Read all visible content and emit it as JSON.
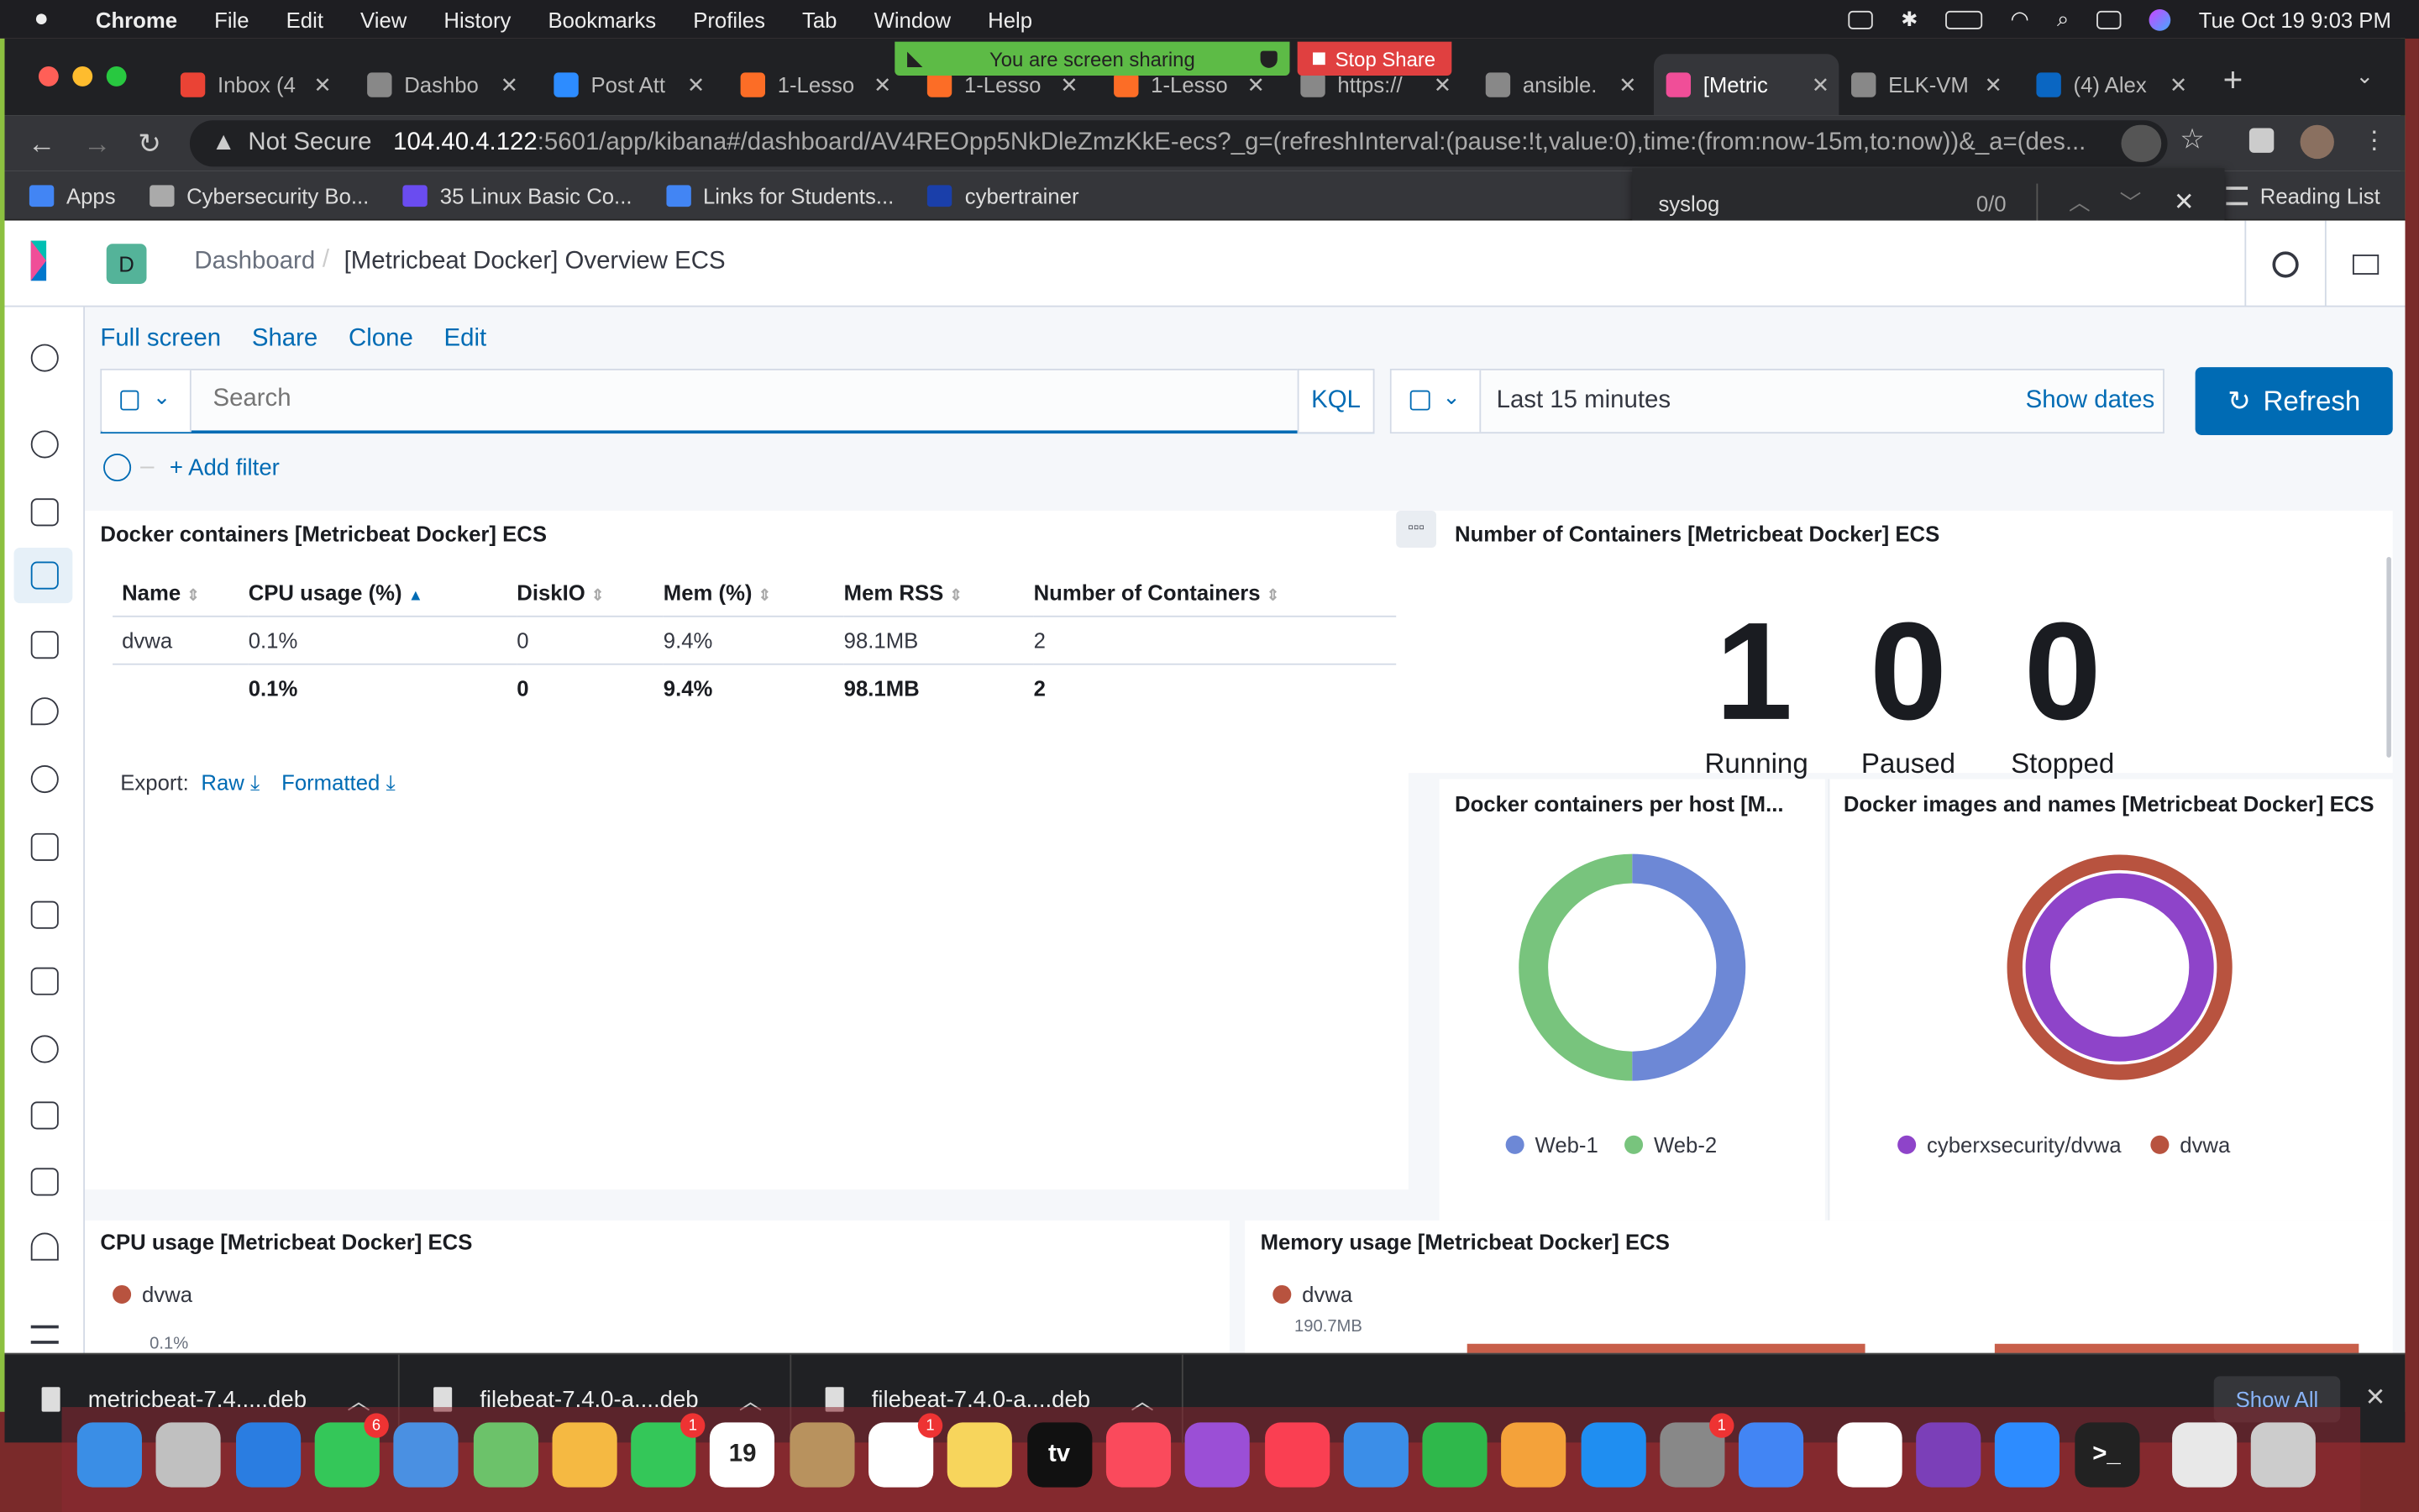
{
  "menubar": {
    "app": "Chrome",
    "items": [
      "File",
      "Edit",
      "View",
      "History",
      "Bookmarks",
      "Profiles",
      "Tab",
      "Window",
      "Help"
    ],
    "clock": "Tue Oct 19  9:03 PM"
  },
  "screen_share": {
    "banner": "You are screen sharing",
    "stop": "Stop Share"
  },
  "tabs": [
    {
      "label": "Inbox (4",
      "color": "#ea4335"
    },
    {
      "label": "Dashbo",
      "color": "#888888"
    },
    {
      "label": "Post Att",
      "color": "#2d8cff"
    },
    {
      "label": "1-Lesso",
      "color": "#fc6d26"
    },
    {
      "label": "1-Lesso",
      "color": "#fc6d26"
    },
    {
      "label": "1-Lesso",
      "color": "#fc6d26"
    },
    {
      "label": "https://",
      "color": "#888888"
    },
    {
      "label": "ansible.",
      "color": "#888888"
    },
    {
      "label": "[Metric",
      "color": "#f04e98"
    },
    {
      "label": "ELK-VM",
      "color": "#888888"
    },
    {
      "label": "(4) Alex",
      "color": "#0a66c2"
    }
  ],
  "address": {
    "security": "Not Secure",
    "host": "104.40.4.122",
    "path": ":5601/app/kibana#/dashboard/AV4REOpp5NkDleZmzKkE-ecs?_g=(refreshInterval:(pause:!t,value:0),time:(from:now-15m,to:now))&_a=(des..."
  },
  "bookmarks": [
    {
      "label": "Apps",
      "color": "#4285f4"
    },
    {
      "label": "Cybersecurity Bo...",
      "color": "#aaaaaa"
    },
    {
      "label": "35 Linux Basic Co...",
      "color": "#6a4cf0"
    },
    {
      "label": "Links for Students...",
      "color": "#4285f4"
    },
    {
      "label": "cybertrainer",
      "color": "#1a3faa"
    }
  ],
  "reading_list": "Reading List",
  "find": {
    "query": "syslog",
    "count": "0/0"
  },
  "kibana": {
    "avatar": "D",
    "breadcrumb_root": "Dashboard",
    "breadcrumb_current": "[Metricbeat Docker] Overview ECS",
    "actions": [
      "Full screen",
      "Share",
      "Clone",
      "Edit"
    ],
    "search_placeholder": "Search",
    "kql": "KQL",
    "time_range": "Last 15 minutes",
    "show_dates": "Show dates",
    "refresh": "Refresh",
    "add_filter": "+ Add filter"
  },
  "panels": {
    "containers_table": {
      "title": "Docker containers [Metricbeat Docker] ECS",
      "columns": [
        "Name",
        "CPU usage (%)",
        "DiskIO",
        "Mem (%)",
        "Mem RSS",
        "Number of Containers"
      ],
      "rows": [
        [
          "dvwa",
          "0.1%",
          "0",
          "9.4%",
          "98.1MB",
          "2"
        ]
      ],
      "totals": [
        "",
        "0.1%",
        "0",
        "9.4%",
        "98.1MB",
        "2"
      ],
      "export_label": "Export:",
      "export_raw": "Raw",
      "export_formatted": "Formatted"
    },
    "num_containers": {
      "title": "Number of Containers [Metricbeat Docker] ECS",
      "metrics": [
        {
          "value": "1",
          "label": "Running"
        },
        {
          "value": "0",
          "label": "Paused"
        },
        {
          "value": "0",
          "label": "Stopped"
        }
      ]
    },
    "per_host": {
      "title": "Docker containers per host [M...",
      "legend": [
        {
          "name": "Web-1",
          "color": "#6d88d6"
        },
        {
          "name": "Web-2",
          "color": "#78c47d"
        }
      ],
      "slices": [
        0.5,
        0.5
      ]
    },
    "images": {
      "title": "Docker images and names [Metricbeat Docker] ECS",
      "legend": [
        {
          "name": "cyberxsecurity/dvwa",
          "color": "#8e44c9"
        },
        {
          "name": "dvwa",
          "color": "#b8533f"
        }
      ]
    },
    "cpu": {
      "title": "CPU usage [Metricbeat Docker] ECS",
      "legend": "dvwa",
      "tick": "0.1%"
    },
    "memory": {
      "title": "Memory usage [Metricbeat Docker] ECS",
      "legend": "dvwa",
      "tick": "190.7MB"
    }
  },
  "downloads": [
    "metricbeat-7.4.....deb",
    "filebeat-7.4.0-a....deb",
    "filebeat-7.4.0-a....deb"
  ],
  "show_all": "Show All",
  "dock": [
    {
      "name": "finder",
      "color": "#3a8ee6"
    },
    {
      "name": "launchpad",
      "color": "#c0c0c0"
    },
    {
      "name": "safari",
      "color": "#2a7de1"
    },
    {
      "name": "messages",
      "color": "#34c759",
      "badge": "6"
    },
    {
      "name": "mail",
      "color": "#4a90e2"
    },
    {
      "name": "maps",
      "color": "#6cc26a"
    },
    {
      "name": "photos",
      "color": "#f5b942"
    },
    {
      "name": "facetime",
      "color": "#34c759",
      "badge": "1"
    },
    {
      "name": "calendar",
      "color": "#ffffff",
      "text": "19"
    },
    {
      "name": "contacts",
      "color": "#b8925e"
    },
    {
      "name": "reminders",
      "color": "#ffffff",
      "badge": "1"
    },
    {
      "name": "notes",
      "color": "#f7d55c"
    },
    {
      "name": "tv",
      "color": "#111111",
      "text": "tv"
    },
    {
      "name": "music",
      "color": "#fa4a5c"
    },
    {
      "name": "podcasts",
      "color": "#9b4fd6"
    },
    {
      "name": "news",
      "color": "#fa3f52"
    },
    {
      "name": "keynote",
      "color": "#3b8ee8"
    },
    {
      "name": "numbers",
      "color": "#2fb84b"
    },
    {
      "name": "pages",
      "color": "#f4a23a"
    },
    {
      "name": "app-store",
      "color": "#1f8ef1"
    },
    {
      "name": "system-preferences",
      "color": "#888888",
      "badge": "1"
    },
    {
      "name": "chrome",
      "color": "#4285f4"
    },
    {
      "name": "slack",
      "color": "#ffffff"
    },
    {
      "name": "onenote",
      "color": "#7b3fb8"
    },
    {
      "name": "zoom",
      "color": "#2d8cff"
    },
    {
      "name": "terminal",
      "color": "#222222",
      "text": ">_"
    },
    {
      "name": "documents",
      "color": "#e8e8e8"
    },
    {
      "name": "trash",
      "color": "#cccccc"
    }
  ]
}
